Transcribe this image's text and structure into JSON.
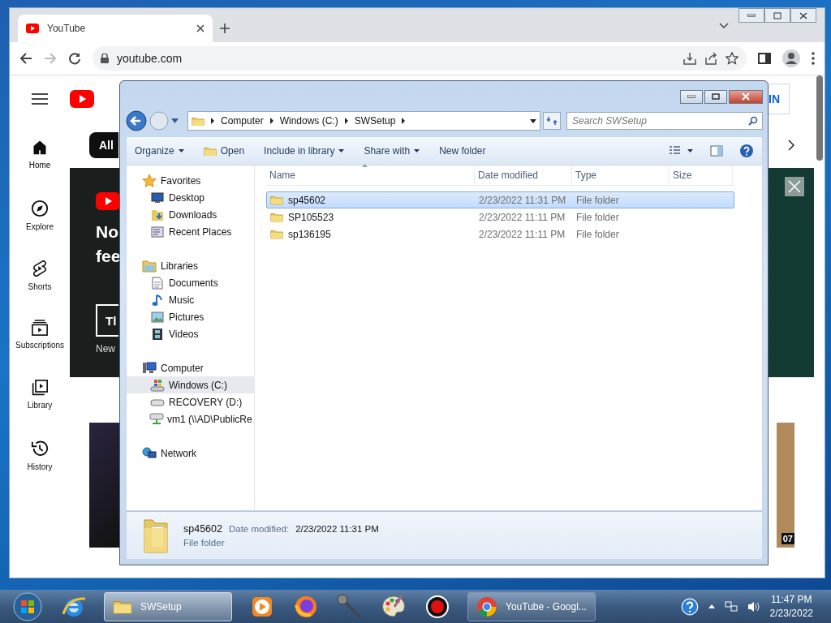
{
  "browser": {
    "tabs": [
      {
        "title": "YouTube",
        "selected": true
      }
    ],
    "url": "youtube.com"
  },
  "youtube": {
    "sign_in": "IN",
    "sidebar": [
      {
        "label": "Home",
        "selected": true
      },
      {
        "label": "Explore",
        "selected": false
      },
      {
        "label": "Shorts",
        "selected": false
      },
      {
        "label": "Subscriptions",
        "selected": false
      },
      {
        "label": "Library",
        "selected": false
      },
      {
        "label": "History",
        "selected": false
      }
    ],
    "chips": [
      {
        "label": "All",
        "selected": true
      }
    ],
    "banner": {
      "lines": [
        "No",
        "fee"
      ],
      "button": "Tl",
      "note": "New"
    },
    "duration": "07"
  },
  "explorer": {
    "breadcrumb": [
      "Computer",
      "Windows (C:)",
      "SWSetup"
    ],
    "search_placeholder": "Search SWSetup",
    "commands": [
      {
        "label": "Organize",
        "dropdown": true
      },
      {
        "label": "Open",
        "dropdown": false
      },
      {
        "label": "Include in library",
        "dropdown": true
      },
      {
        "label": "Share with",
        "dropdown": true
      },
      {
        "label": "New folder",
        "dropdown": false
      }
    ],
    "nav": [
      {
        "label": "Favorites",
        "kind": "star",
        "children": [
          {
            "label": "Desktop",
            "kind": "desktop",
            "selected": false
          },
          {
            "label": "Downloads",
            "kind": "downloads",
            "selected": false
          },
          {
            "label": "Recent Places",
            "kind": "recent",
            "selected": false
          }
        ]
      },
      {
        "label": "Libraries",
        "kind": "library",
        "children": [
          {
            "label": "Documents",
            "kind": "document",
            "selected": false
          },
          {
            "label": "Music",
            "kind": "music",
            "selected": false
          },
          {
            "label": "Pictures",
            "kind": "pictures",
            "selected": false
          },
          {
            "label": "Videos",
            "kind": "videos",
            "selected": false
          }
        ]
      },
      {
        "label": "Computer",
        "kind": "computer",
        "children": [
          {
            "label": "Windows (C:)",
            "kind": "windrive",
            "selected": true
          },
          {
            "label": "RECOVERY (D:)",
            "kind": "drive",
            "selected": false
          },
          {
            "label": "vm1 (\\\\AD\\PublicRe",
            "kind": "netdrive",
            "selected": false
          }
        ]
      },
      {
        "label": "Network",
        "kind": "network"
      }
    ],
    "columns": [
      "Name",
      "Date modified",
      "Type",
      "Size"
    ],
    "rows": [
      {
        "name": "sp45602",
        "date": "2/23/2022 11:31 PM",
        "type": "File folder",
        "selected": true
      },
      {
        "name": "SP105523",
        "date": "2/23/2022 11:11 PM",
        "type": "File folder",
        "selected": false
      },
      {
        "name": "sp136195",
        "date": "2/23/2022 11:11 PM",
        "type": "File folder",
        "selected": false
      }
    ],
    "details": {
      "name": "sp45602",
      "date_label": "Date modified:",
      "date": "2/23/2022 11:31 PM",
      "type": "File folder"
    }
  },
  "taskbar": {
    "items": [
      {
        "kind": "pinned"
      },
      {
        "kind": "window",
        "label": "SWSetup",
        "selected": true
      },
      {
        "kind": "pinned"
      },
      {
        "kind": "pinned"
      },
      {
        "kind": "pinned"
      },
      {
        "kind": "pinned"
      },
      {
        "kind": "pinned"
      },
      {
        "kind": "window",
        "label": "YouTube - Googl...",
        "selected": false
      }
    ],
    "time": "11:47 PM",
    "date": "2/23/2022"
  }
}
